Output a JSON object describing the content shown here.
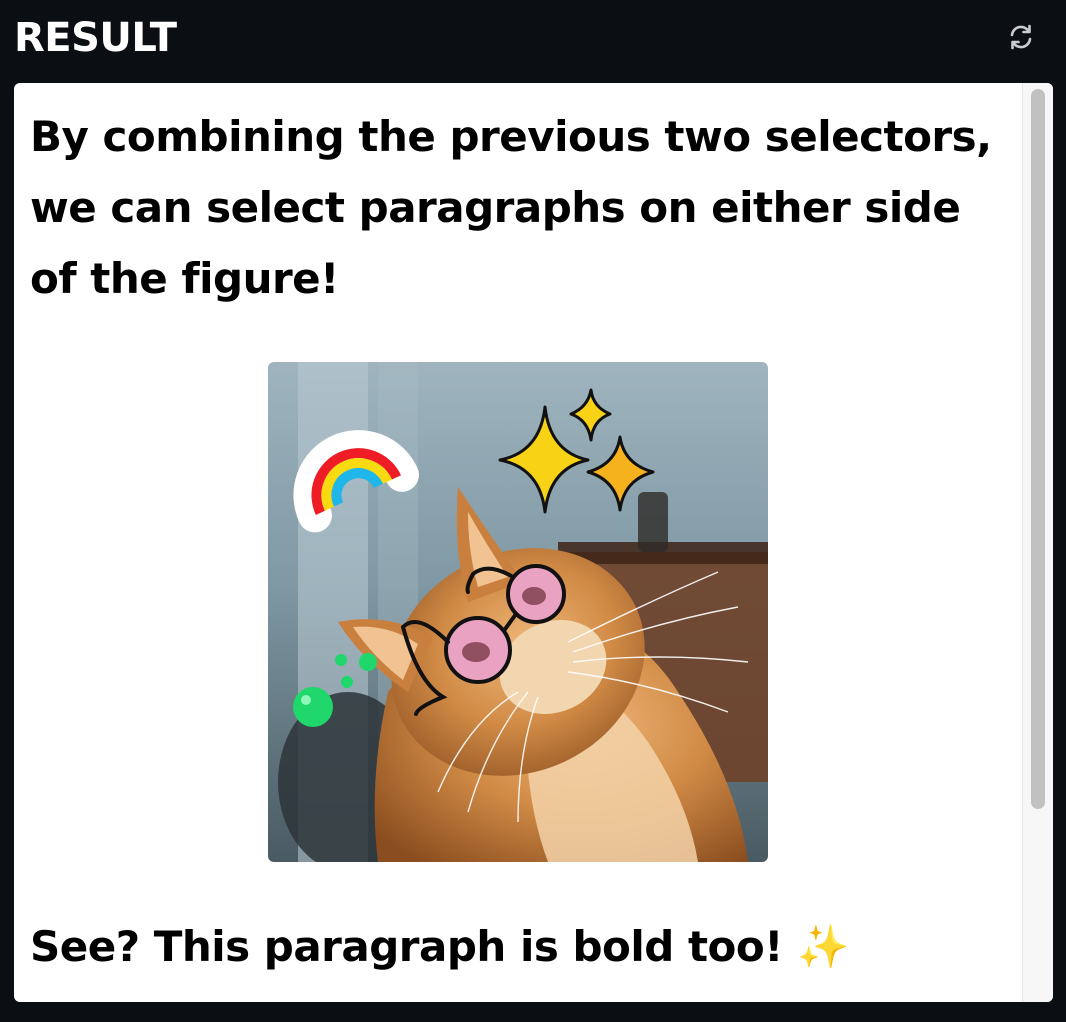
{
  "header": {
    "title": "RESULT",
    "refresh_icon": "refresh-icon"
  },
  "content": {
    "paragraph_top": "By combining the previous two selectors, we can select paragraphs on either side of the figure!",
    "paragraph_bottom": "See? This paragraph is bold too! ✨",
    "figure_alt": "cat with glasses, sparkles, rainbow and bubbles"
  },
  "colors": {
    "background": "#0b0f14",
    "panel": "#ffffff",
    "scrollbar_thumb": "#c1c1c1"
  }
}
